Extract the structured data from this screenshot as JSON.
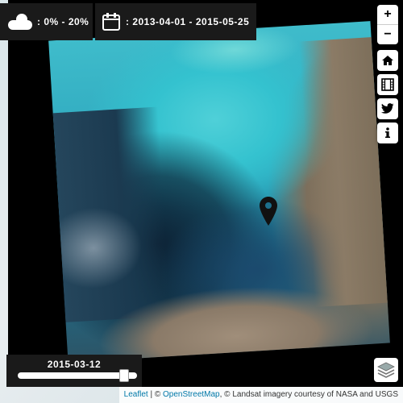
{
  "cloud_filter": {
    "icon": "cloud-icon",
    "label": ": 0% - 20%"
  },
  "date_filter": {
    "icon": "calendar-icon",
    "label": ": 2013-04-01 - 2015-05-25"
  },
  "zoom": {
    "in_label": "+",
    "out_label": "−"
  },
  "side_buttons": [
    {
      "icon": "home-icon"
    },
    {
      "icon": "film-icon"
    },
    {
      "icon": "twitter-icon"
    },
    {
      "icon": "info-icon"
    }
  ],
  "timeline": {
    "current_date": "2015-03-12",
    "position_fraction": 0.93
  },
  "layers": {
    "icon": "layers-icon"
  },
  "attribution": {
    "leaflet": "Leaflet",
    "sep1": " | © ",
    "osm": "OpenStreetMap",
    "rest": ", © Landsat imagery courtesy of NASA and USGS"
  },
  "colors": {
    "panel": "#1a1a1a",
    "link": "#0078a8"
  }
}
